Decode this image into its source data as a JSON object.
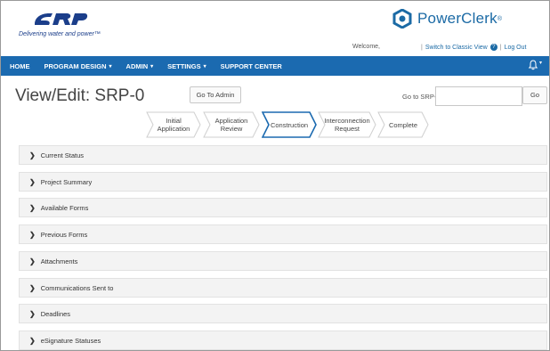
{
  "header": {
    "tagline": "Delivering water and power™",
    "brand_name": "PowerClerk",
    "brand_mark": "®",
    "welcome": "Welcome,",
    "classic_view_link": "Switch to Classic View",
    "logout_link": "Log Out",
    "link_separator": "|",
    "help_glyph": "?"
  },
  "nav": {
    "items": [
      {
        "label": "HOME",
        "has_menu": false
      },
      {
        "label": "PROGRAM DESIGN",
        "has_menu": true
      },
      {
        "label": "ADMIN",
        "has_menu": true
      },
      {
        "label": "SETTINGS",
        "has_menu": true
      },
      {
        "label": "SUPPORT CENTER",
        "has_menu": false
      }
    ],
    "caret": "▾",
    "bell_glyph": "🔔",
    "bell_caret": "▾",
    "bar_color": "#1b6ab0"
  },
  "page": {
    "title": "View/Edit: SRP-0",
    "go_to_admin": "Go To Admin",
    "go_to_label": "Go to SRP-",
    "go_to_value": "",
    "go_button": "Go"
  },
  "progress": {
    "steps": [
      {
        "line1": "Initial",
        "line2": "Application",
        "active": false
      },
      {
        "line1": "Application",
        "line2": "Review",
        "active": false
      },
      {
        "line1": "Construction",
        "line2": "",
        "active": true
      },
      {
        "line1": "Interconnection",
        "line2": "Request",
        "active": false
      },
      {
        "line1": "Complete",
        "line2": "",
        "active": false
      }
    ],
    "active_color": "#1b6ab0"
  },
  "sections": [
    "Current Status",
    "Project Summary",
    "Available Forms",
    "Previous Forms",
    "Attachments",
    "Communications Sent to",
    "Deadlines",
    "eSignature Statuses"
  ],
  "section_chevron": "❯"
}
